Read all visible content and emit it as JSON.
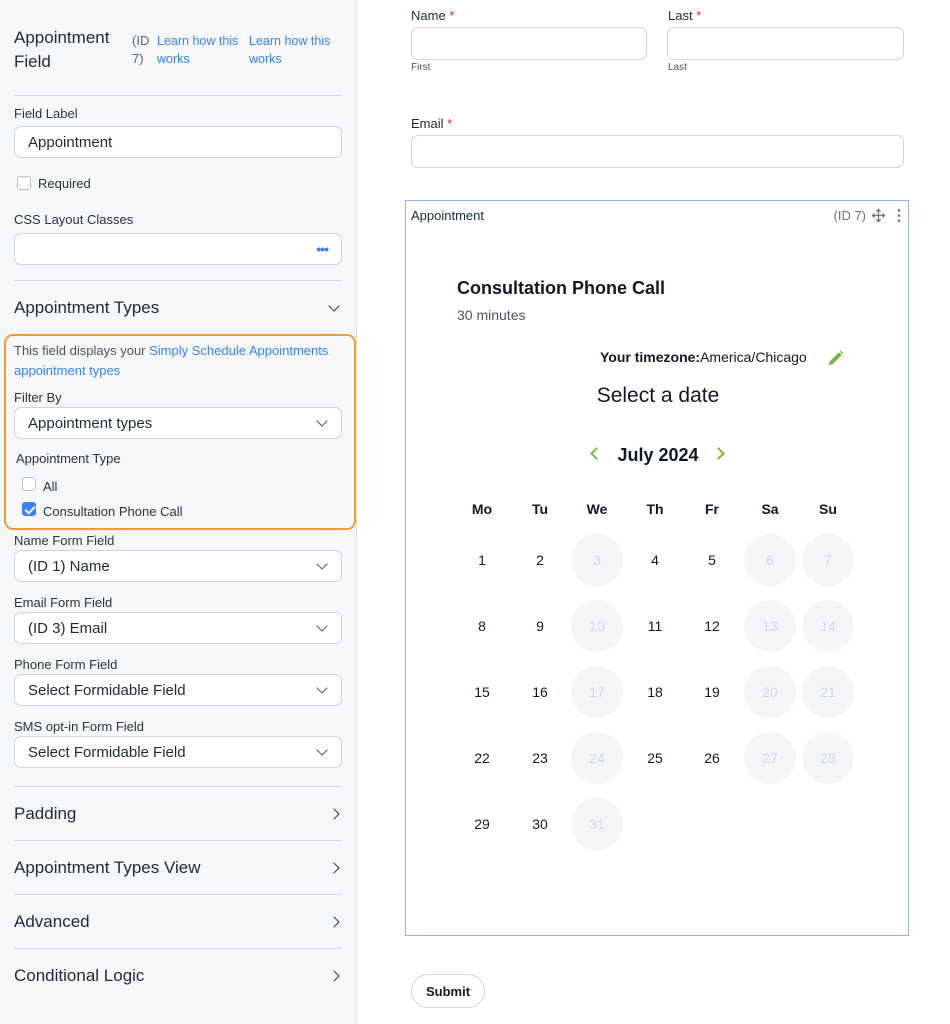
{
  "sidebar": {
    "title": "Appointment Field",
    "id_text": "(ID 7)",
    "learn_link_1": "Learn how this works",
    "learn_link_2": "Learn how this works",
    "field_label_label": "Field Label",
    "field_label_value": "Appointment",
    "required_label": "Required",
    "required_checked": false,
    "css_classes_label": "CSS Layout Classes",
    "css_classes_value": "",
    "css_more_icon": "•••",
    "appointment_types_section": "Appointment Types",
    "hint_prefix": "This field displays your ",
    "hint_link": "Simply Schedule Appointments appointment types",
    "filter_by_label": "Filter By",
    "filter_by_value": "Appointment types",
    "appointment_type_label": "Appointment Type",
    "option_all": "All",
    "option_all_checked": false,
    "option_consultation": "Consultation Phone Call",
    "option_consultation_checked": true,
    "name_field_label": "Name Form Field",
    "name_field_value": "(ID 1) Name",
    "email_field_label": "Email Form Field",
    "email_field_value": "(ID 3) Email",
    "phone_field_label": "Phone Form Field",
    "phone_field_value": "Select Formidable Field",
    "sms_field_label": "SMS opt-in Form Field",
    "sms_field_value": "Select Formidable Field",
    "sections": [
      {
        "label": "Padding"
      },
      {
        "label": "Appointment Types View"
      },
      {
        "label": "Advanced"
      },
      {
        "label": "Conditional Logic"
      }
    ]
  },
  "form": {
    "name_label": "Name",
    "last_label": "Last",
    "required_mark": "*",
    "first_sub": "First",
    "last_sub": "Last",
    "email_label": "Email",
    "appointment_label": "Appointment",
    "appointment_id": "(ID 7)",
    "submit_label": "Submit"
  },
  "calendar": {
    "title": "Consultation Phone Call",
    "duration": "30 minutes",
    "timezone_label": "Your timezone:",
    "timezone_value": "America/Chicago",
    "select_date": "Select a date",
    "month": "July 2024",
    "weekdays": [
      "Mo",
      "Tu",
      "We",
      "Th",
      "Fr",
      "Sa",
      "Su"
    ],
    "weeks": [
      [
        {
          "d": "1",
          "a": true
        },
        {
          "d": "2",
          "a": true
        },
        {
          "d": "3",
          "a": false
        },
        {
          "d": "4",
          "a": true
        },
        {
          "d": "5",
          "a": true
        },
        {
          "d": "6",
          "a": false
        },
        {
          "d": "7",
          "a": false
        }
      ],
      [
        {
          "d": "8",
          "a": true
        },
        {
          "d": "9",
          "a": true
        },
        {
          "d": "10",
          "a": false
        },
        {
          "d": "11",
          "a": true
        },
        {
          "d": "12",
          "a": true
        },
        {
          "d": "13",
          "a": false
        },
        {
          "d": "14",
          "a": false
        }
      ],
      [
        {
          "d": "15",
          "a": true
        },
        {
          "d": "16",
          "a": true
        },
        {
          "d": "17",
          "a": false
        },
        {
          "d": "18",
          "a": true
        },
        {
          "d": "19",
          "a": true
        },
        {
          "d": "20",
          "a": false
        },
        {
          "d": "21",
          "a": false
        }
      ],
      [
        {
          "d": "22",
          "a": true
        },
        {
          "d": "23",
          "a": true
        },
        {
          "d": "24",
          "a": false
        },
        {
          "d": "25",
          "a": true
        },
        {
          "d": "26",
          "a": true
        },
        {
          "d": "27",
          "a": false
        },
        {
          "d": "28",
          "a": false
        }
      ],
      [
        {
          "d": "29",
          "a": true
        },
        {
          "d": "30",
          "a": true
        },
        {
          "d": "31",
          "a": false
        }
      ]
    ]
  },
  "colors": {
    "accent_blue": "#3b82f6",
    "highlight_orange": "#f39a34",
    "nav_green": "#7cb342",
    "required_red": "#dc2626"
  },
  "icons": {
    "move": "move-icon",
    "more": "more-vertical-icon",
    "edit": "pencil-icon",
    "prev": "chevron-left-icon",
    "next": "chevron-right-icon"
  }
}
